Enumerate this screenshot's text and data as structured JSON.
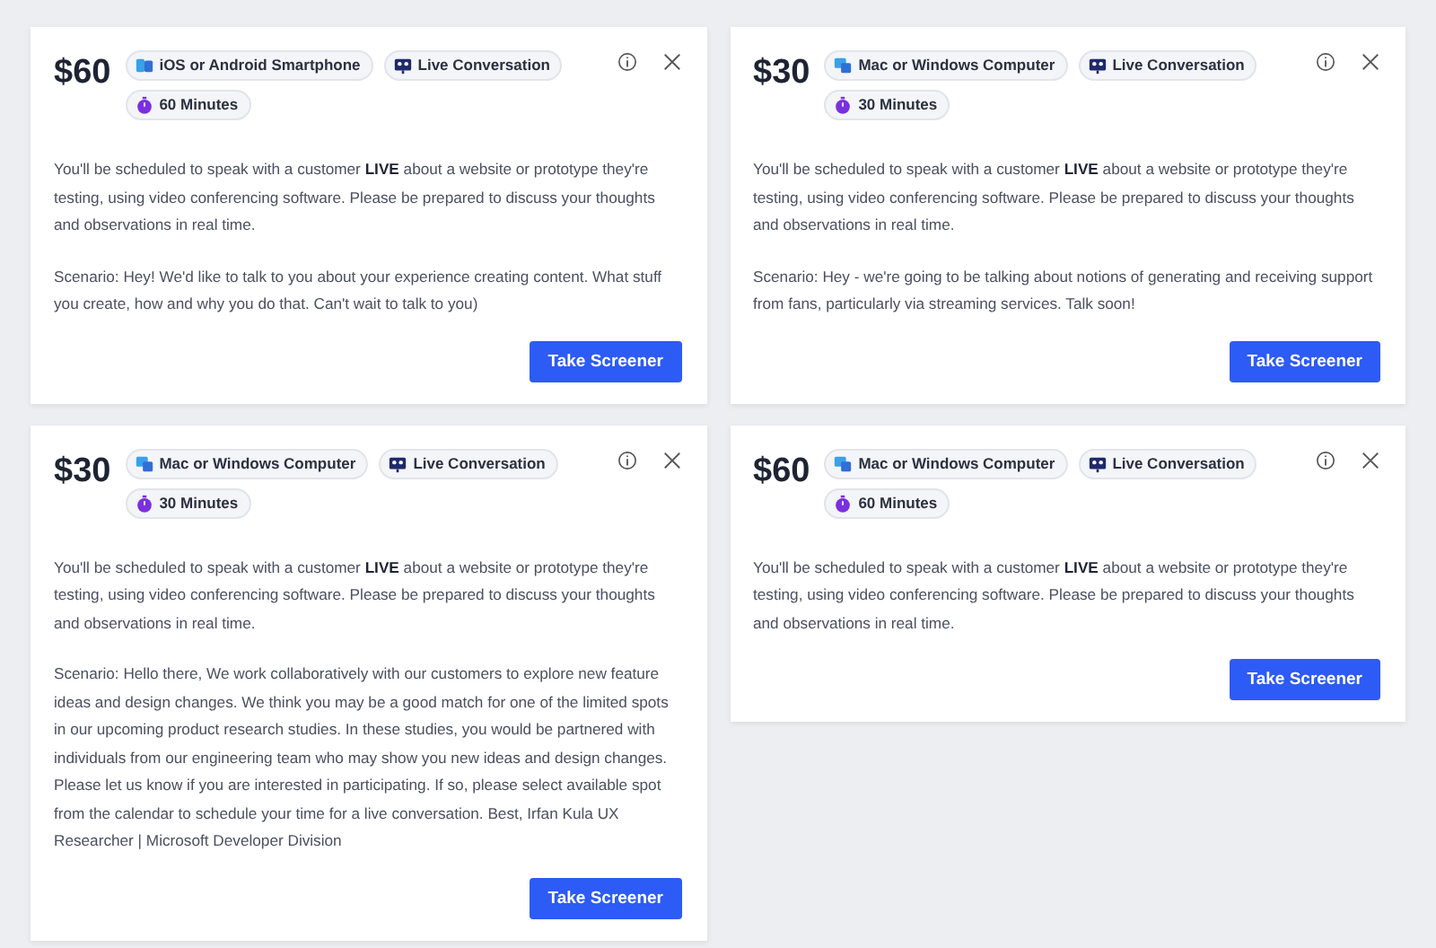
{
  "columns": [
    {
      "cards": [
        {
          "price": "$60",
          "tags": [
            {
              "kind": "device",
              "label": "iOS or Android Smartphone"
            },
            {
              "kind": "live",
              "label": "Live Conversation"
            },
            {
              "kind": "time",
              "label": "60 Minutes"
            }
          ],
          "description": "You'll be scheduled to speak with a customer **LIVE** about a website or prototype they're testing, using video conferencing software. Please be prepared to discuss your thoughts and observations in real time.",
          "scenario": "Scenario: Hey! We'd like to talk to you about your experience creating content. What stuff you create, how and why you do that. Can't wait to talk to you)",
          "button": "Take Screener"
        },
        {
          "price": "$30",
          "tags": [
            {
              "kind": "computer",
              "label": "Mac or Windows Computer"
            },
            {
              "kind": "live",
              "label": "Live Conversation"
            },
            {
              "kind": "time",
              "label": "30 Minutes"
            }
          ],
          "description": "You'll be scheduled to speak with a customer **LIVE** about a website or prototype they're testing, using video conferencing software. Please be prepared to discuss your thoughts and observations in real time.",
          "scenario": "Scenario: Hello there, We work collaboratively with our customers to explore new feature ideas and design changes. We think you may be a good match for one of the limited spots in our upcoming product research studies. In these studies, you would be partnered with individuals from our engineering team who may show you new ideas and design changes. Please let us know if you are interested in participating. If so, please select available spot from the calendar to schedule your time for a live conversation. Best, Irfan Kula UX Researcher | Microsoft Developer Division",
          "button": "Take Screener"
        }
      ]
    },
    {
      "cards": [
        {
          "price": "$30",
          "tags": [
            {
              "kind": "computer",
              "label": "Mac or Windows Computer"
            },
            {
              "kind": "live",
              "label": "Live Conversation"
            },
            {
              "kind": "time",
              "label": "30 Minutes"
            }
          ],
          "description": "You'll be scheduled to speak with a customer **LIVE** about a website or prototype they're testing, using video conferencing software. Please be prepared to discuss your thoughts and observations in real time.",
          "scenario": "Scenario: Hey - we're going to be talking about notions of generating and receiving support from fans, particularly via streaming services. Talk soon!",
          "button": "Take Screener"
        },
        {
          "price": "$60",
          "tags": [
            {
              "kind": "computer",
              "label": "Mac or Windows Computer"
            },
            {
              "kind": "live",
              "label": "Live Conversation"
            },
            {
              "kind": "time",
              "label": "60 Minutes"
            }
          ],
          "description": "You'll be scheduled to speak with a customer **LIVE** about a website or prototype they're testing, using video conferencing software. Please be prepared to discuss your thoughts and observations in real time.",
          "button": "Take Screener"
        }
      ]
    }
  ]
}
